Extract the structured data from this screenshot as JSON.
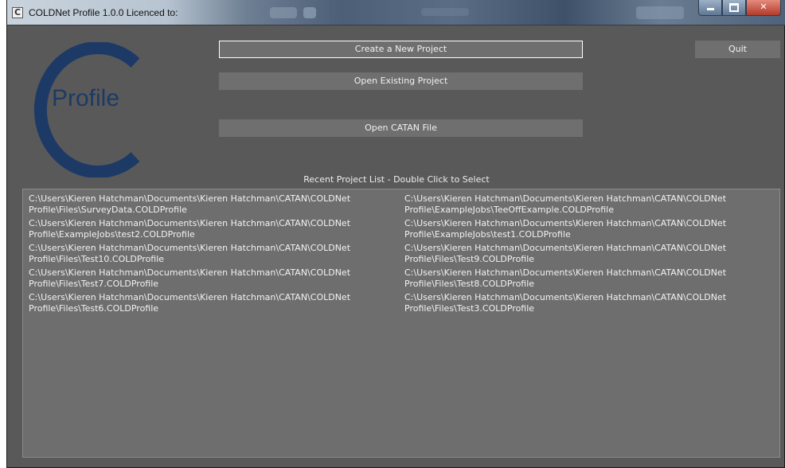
{
  "window": {
    "title": "COLDNet Profile 1.0.0   Licenced to:",
    "app_icon_letter": "C"
  },
  "logo": {
    "letter": "C",
    "text": "Profile",
    "color": "#1d3a66"
  },
  "actions": {
    "create_label": "Create a New Project",
    "open_label": "Open Existing Project",
    "catan_label": "Open CATAN File",
    "quit_label": "Quit"
  },
  "recent": {
    "heading": "Recent Project List - Double Click to Select",
    "items": [
      "C:\\Users\\Kieren Hatchman\\Documents\\Kieren Hatchman\\CATAN\\COLDNet Profile\\Files\\SurveyData.COLDProfile",
      "C:\\Users\\Kieren Hatchman\\Documents\\Kieren Hatchman\\CATAN\\COLDNet Profile\\ExampleJobs\\TeeOffExample.COLDProfile",
      "C:\\Users\\Kieren Hatchman\\Documents\\Kieren Hatchman\\CATAN\\COLDNet Profile\\ExampleJobs\\test2.COLDProfile",
      "C:\\Users\\Kieren Hatchman\\Documents\\Kieren Hatchman\\CATAN\\COLDNet Profile\\ExampleJobs\\test1.COLDProfile",
      "C:\\Users\\Kieren Hatchman\\Documents\\Kieren Hatchman\\CATAN\\COLDNet Profile\\Files\\Test10.COLDProfile",
      "C:\\Users\\Kieren Hatchman\\Documents\\Kieren Hatchman\\CATAN\\COLDNet Profile\\Files\\Test9.COLDProfile",
      "C:\\Users\\Kieren Hatchman\\Documents\\Kieren Hatchman\\CATAN\\COLDNet Profile\\Files\\Test7.COLDProfile",
      "C:\\Users\\Kieren Hatchman\\Documents\\Kieren Hatchman\\CATAN\\COLDNet Profile\\Files\\Test8.COLDProfile",
      "C:\\Users\\Kieren Hatchman\\Documents\\Kieren Hatchman\\CATAN\\COLDNet Profile\\Files\\Test6.COLDProfile",
      "C:\\Users\\Kieren Hatchman\\Documents\\Kieren Hatchman\\CATAN\\COLDNet Profile\\Files\\Test3.COLDProfile"
    ]
  }
}
